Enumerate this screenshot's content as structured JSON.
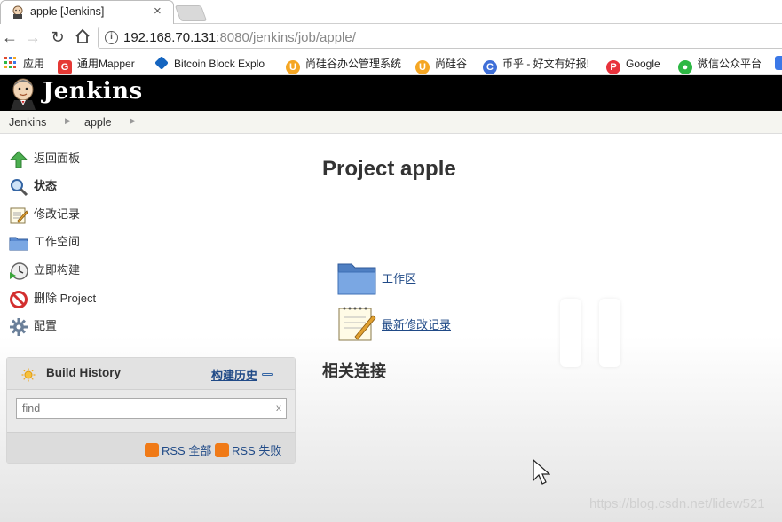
{
  "browser": {
    "tab_title": "apple [Jenkins]",
    "tab_close": "×",
    "url_host": "192.168.70.131",
    "url_rest": ":8080/jenkins/job/apple/",
    "bookmarks": [
      {
        "label": "应用",
        "color": "#e04a2f"
      },
      {
        "label": "通用Mapper",
        "color": "#e53935"
      },
      {
        "label": "Bitcoin Block Explo",
        "color": "#1565c0"
      },
      {
        "label": "尚硅谷办公管理系统",
        "color": "#f5a623"
      },
      {
        "label": "尚硅谷",
        "color": "#f5a623"
      },
      {
        "label": "币乎 - 好文有好报!",
        "color": "#3f6fd8"
      },
      {
        "label": "Google",
        "color": "#e8323c"
      },
      {
        "label": "微信公众平台",
        "color": "#2db844"
      }
    ]
  },
  "jenkins": {
    "brand": "Jenkins",
    "breadcrumb": [
      "Jenkins",
      "apple"
    ],
    "tasks": [
      {
        "label": "返回面板",
        "icon": "up-arrow-icon"
      },
      {
        "label": "状态",
        "icon": "search-icon"
      },
      {
        "label": "修改记录",
        "icon": "notepad-icon"
      },
      {
        "label": "工作空间",
        "icon": "folder-icon"
      },
      {
        "label": "立即构建",
        "icon": "clock-play-icon"
      },
      {
        "label": "删除 Project",
        "icon": "no-entry-icon"
      },
      {
        "label": "配置",
        "icon": "gear-icon"
      }
    ],
    "build_history": {
      "title": "Build History",
      "trend_link": "构建历史",
      "find_placeholder": "find",
      "clear": "x",
      "rss_all": "RSS 全部",
      "rss_failed": "RSS 失败"
    },
    "main": {
      "title": "Project apple",
      "workspace_link": "工作区",
      "changes_link": "最新修改记录",
      "related_heading": "相关连接"
    }
  },
  "watermark": "https://blog.csdn.net/lidew521",
  "colors": {
    "link": "#204a87",
    "header_bg": "#000000",
    "rss": "#f07a17"
  }
}
